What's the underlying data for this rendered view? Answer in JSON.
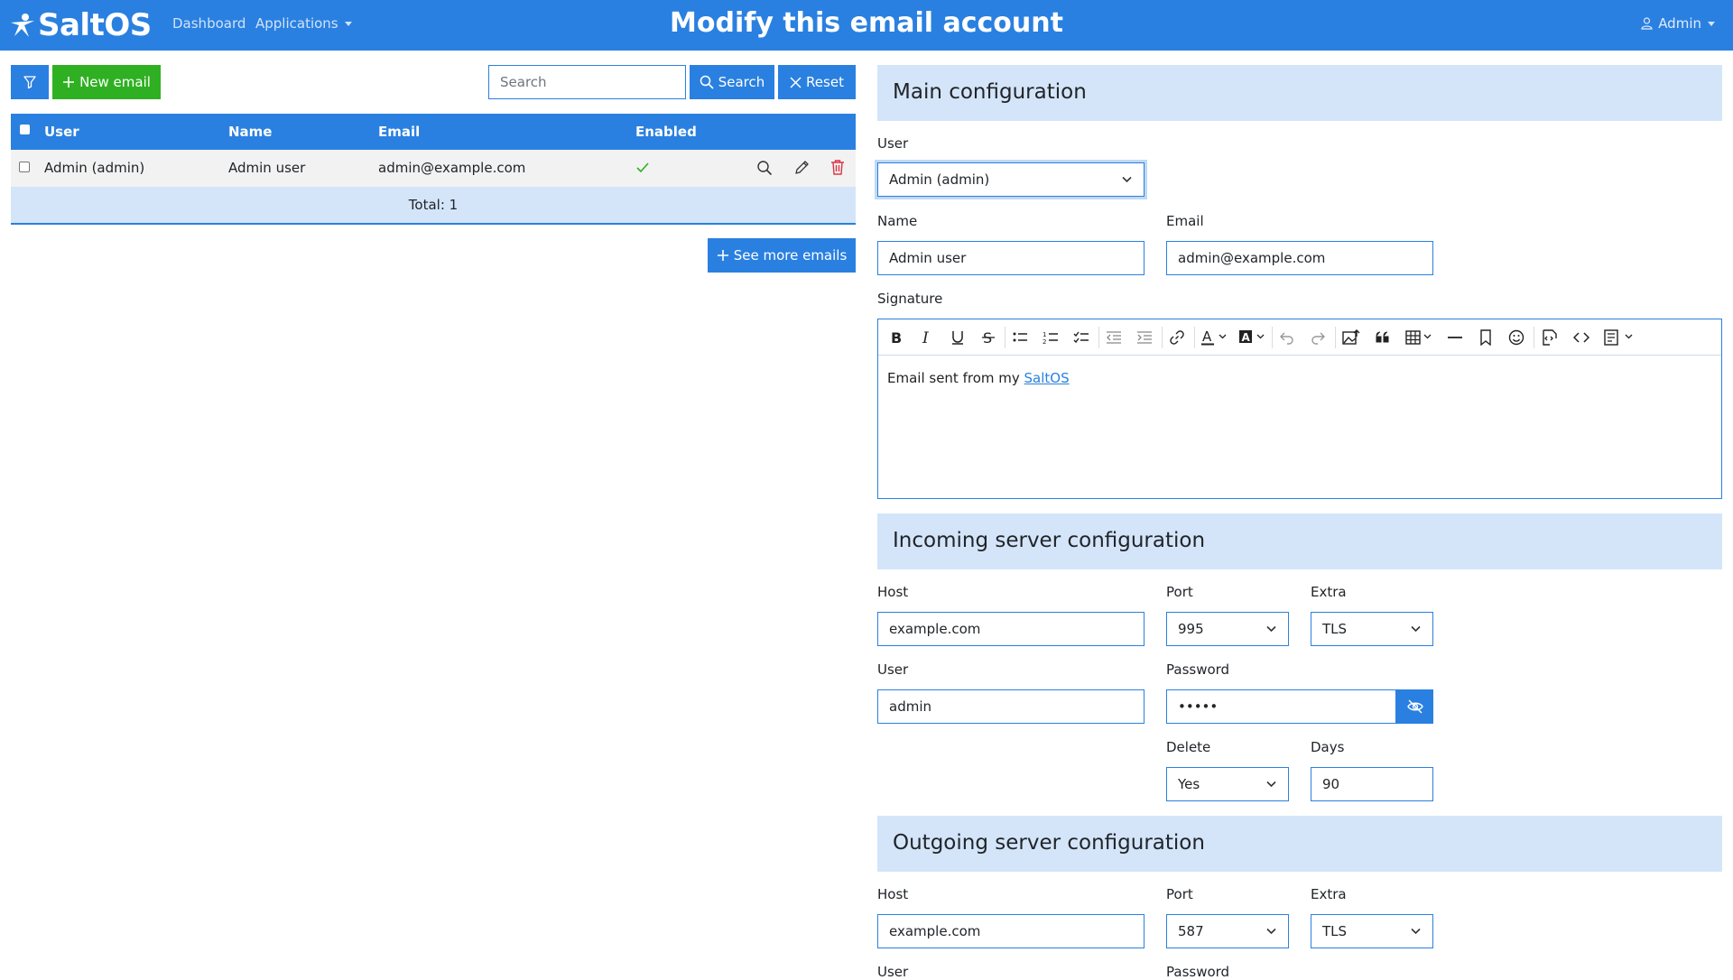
{
  "navbar": {
    "brand": "SaltOS",
    "dashboard": "Dashboard",
    "applications": "Applications",
    "title": "Modify this email account",
    "user": "Admin"
  },
  "list": {
    "new_email": "New email",
    "search_placeholder": "Search",
    "search_button": "Search",
    "reset_button": "Reset",
    "columns": [
      "User",
      "Name",
      "Email",
      "Enabled"
    ],
    "rows": [
      {
        "user": "Admin (admin)",
        "name": "Admin user",
        "email": "admin@example.com",
        "enabled": true
      }
    ],
    "total": "Total: 1",
    "see_more": "See more emails"
  },
  "main_config": {
    "title": "Main configuration",
    "user_label": "User",
    "user_value": "Admin (admin)",
    "name_label": "Name",
    "name_value": "Admin user",
    "email_label": "Email",
    "email_value": "admin@example.com",
    "signature_label": "Signature",
    "signature_text": "Email sent from my",
    "signature_link": "SaltOS"
  },
  "incoming": {
    "title": "Incoming server configuration",
    "host_label": "Host",
    "host_value": "example.com",
    "port_label": "Port",
    "port_value": "995",
    "extra_label": "Extra",
    "extra_value": "TLS",
    "user_label": "User",
    "user_value": "admin",
    "password_label": "Password",
    "password_value": "•••••",
    "delete_label": "Delete",
    "delete_value": "Yes",
    "days_label": "Days",
    "days_value": "90"
  },
  "outgoing": {
    "title": "Outgoing server configuration",
    "host_label": "Host",
    "host_value": "example.com",
    "port_label": "Port",
    "port_value": "587",
    "extra_label": "Extra",
    "extra_value": "TLS",
    "user_label": "User",
    "password_label": "Password"
  },
  "colors": {
    "primary": "#2a80e0",
    "success": "#2fb022",
    "danger": "#dc3545",
    "section_bg": "#d4e5fa"
  }
}
